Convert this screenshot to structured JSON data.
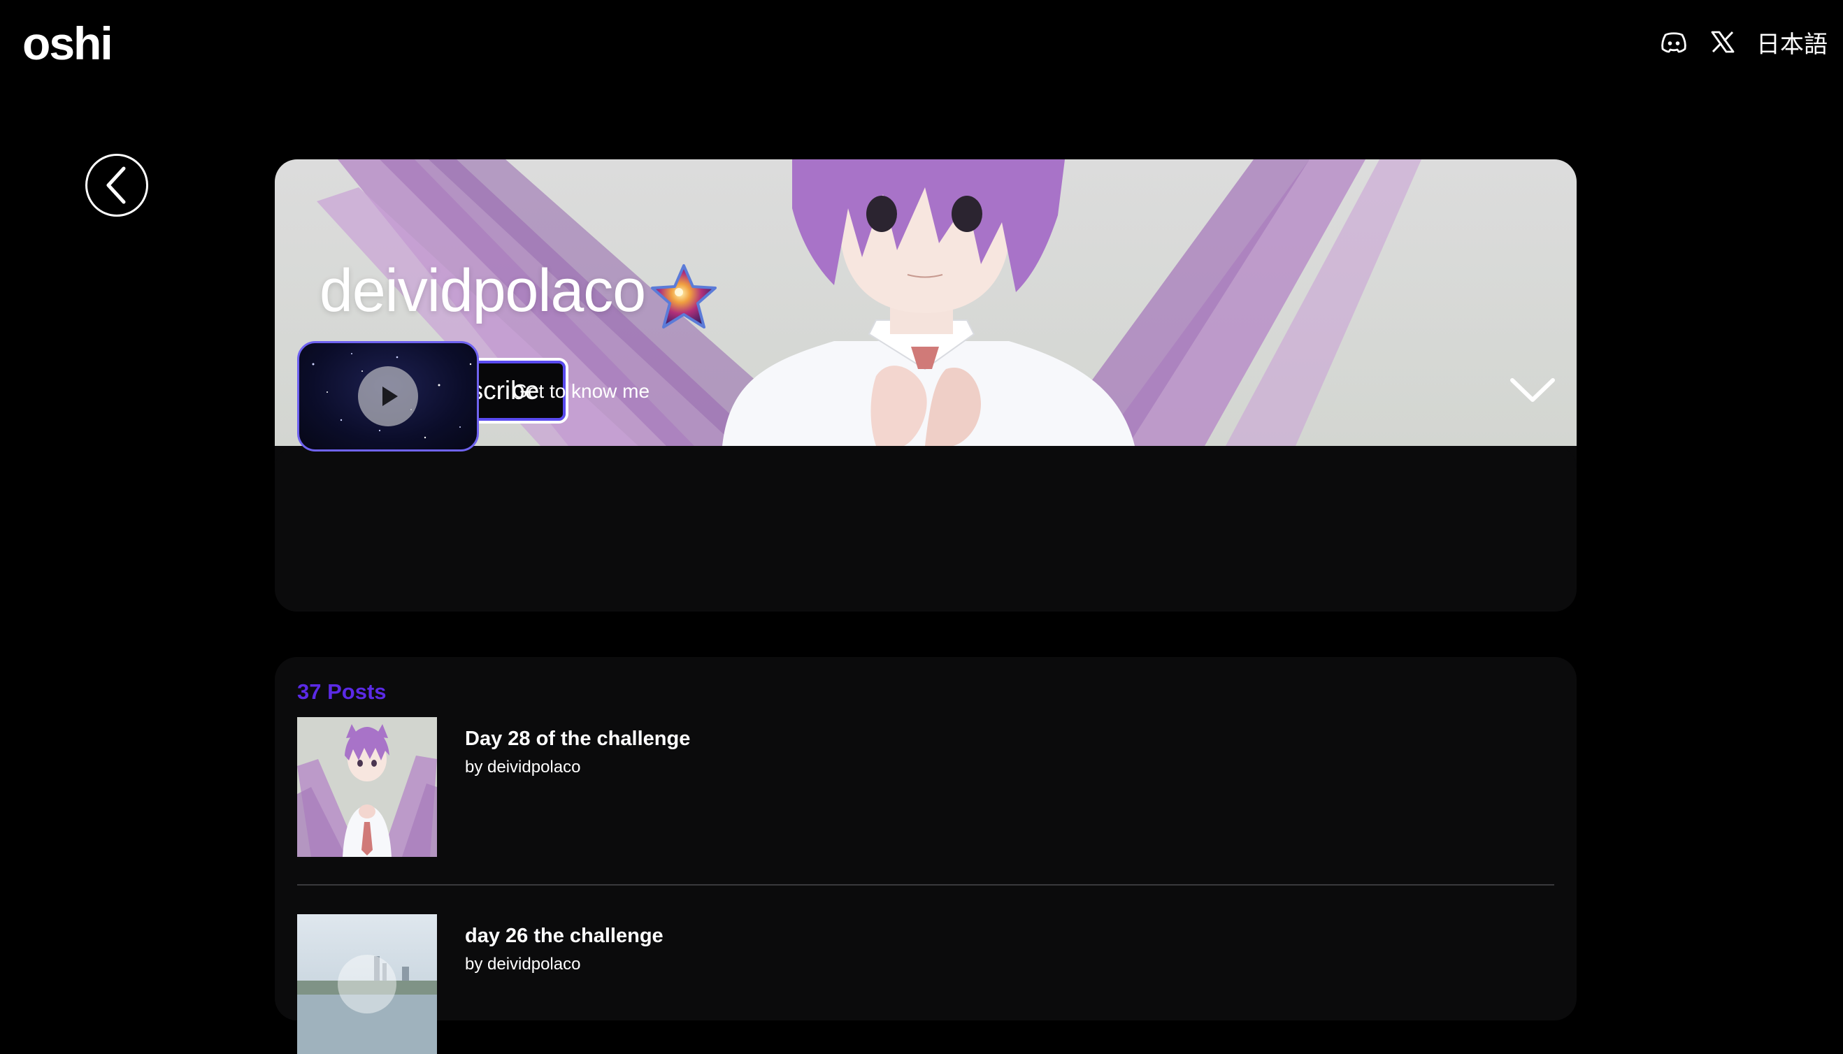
{
  "header": {
    "logo": "oshi",
    "discord_icon": "discord-icon",
    "x_icon": "x-icon",
    "language": "日本語"
  },
  "back": {
    "icon": "chevron-left-icon"
  },
  "profile": {
    "username": "deividpolaco",
    "badge_icon": "star-badge-icon",
    "share_icon": "share-arrow-icon",
    "subscribe_label": "Subscribe",
    "intro": {
      "label": "Get to know me",
      "play_icon": "play-icon",
      "expand_icon": "chevron-down-icon"
    }
  },
  "posts": {
    "count_label": "37 Posts",
    "items": [
      {
        "title": "Day 28 of the challenge",
        "author": "by deividpolaco"
      },
      {
        "title": "day 26 the challenge",
        "author": "by deividpolaco"
      }
    ]
  },
  "colors": {
    "background": "#000000",
    "card": "#0b0b0c",
    "accent_purple": "#5b2ae6",
    "subscribe_border": "#5a4bf0",
    "video_border": "#6f63f0"
  }
}
